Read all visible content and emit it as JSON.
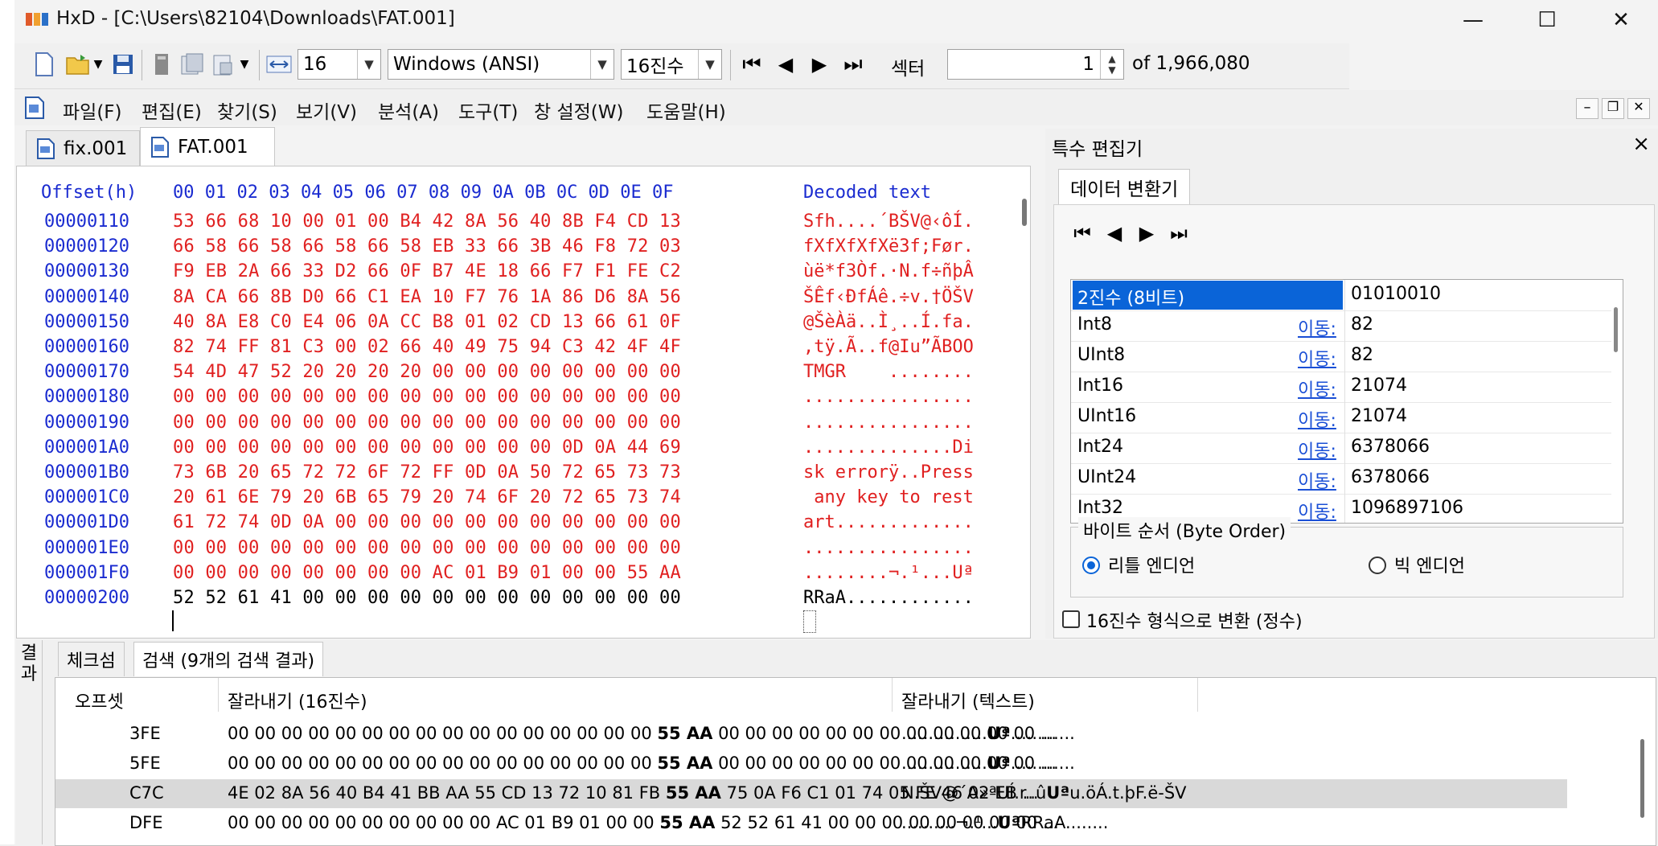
{
  "window": {
    "title": "HxD - [C:\\Users\\82104\\Downloads\\FAT.001]",
    "minimize": "—",
    "maximize": "☐",
    "close": "✕"
  },
  "toolbar": {
    "bytes_per_row": "16",
    "charset": "Windows (ANSI)",
    "number_base": "16진수",
    "sector_label": "섹터",
    "sector_value": "1",
    "sector_total": "of 1,966,080"
  },
  "menu": [
    "파일(F)",
    "편집(E)",
    "찾기(S)",
    "보기(V)",
    "분석(A)",
    "도구(T)",
    "창 설정(W)",
    "도움말(H)"
  ],
  "mdi_buttons": [
    "–",
    "❐",
    "✕"
  ],
  "tabs": [
    {
      "label": "fix.001",
      "active": false
    },
    {
      "label": "FAT.001",
      "active": true
    }
  ],
  "hex": {
    "header_offset": "Offset(h)",
    "header_bytes": "00 01 02 03 04 05 06 07 08 09 0A 0B 0C 0D 0E 0F",
    "header_text": "Decoded text",
    "rows": [
      {
        "offset": "00000110",
        "bytes": "53 66 68 10 00 01 00 B4 42 8A 56 40 8B F4 CD 13",
        "text": "Sfh....´BŠV@‹ôÍ."
      },
      {
        "offset": "00000120",
        "bytes": "66 58 66 58 66 58 66 58 EB 33 66 3B 46 F8 72 03",
        "text": "fXfXfXfXë3f;Før."
      },
      {
        "offset": "00000130",
        "bytes": "F9 EB 2A 66 33 D2 66 0F B7 4E 18 66 F7 F1 FE C2",
        "text": "ùë*f3Òf.·N.f÷ñþÂ"
      },
      {
        "offset": "00000140",
        "bytes": "8A CA 66 8B D0 66 C1 EA 10 F7 76 1A 86 D6 8A 56",
        "text": "ŠÊf‹ÐfÁê.÷v.†ÖŠV"
      },
      {
        "offset": "00000150",
        "bytes": "40 8A E8 C0 E4 06 0A CC B8 01 02 CD 13 66 61 0F",
        "text": "@ŠèÀä..Ì¸..Í.fa."
      },
      {
        "offset": "00000160",
        "bytes": "82 74 FF 81 C3 00 02 66 40 49 75 94 C3 42 4F 4F",
        "text": "‚tÿ.Ã..f@Iu”ÃBOO"
      },
      {
        "offset": "00000170",
        "bytes": "54 4D 47 52 20 20 20 20 00 00 00 00 00 00 00 00",
        "text": "TMGR    ........"
      },
      {
        "offset": "00000180",
        "bytes": "00 00 00 00 00 00 00 00 00 00 00 00 00 00 00 00",
        "text": "................"
      },
      {
        "offset": "00000190",
        "bytes": "00 00 00 00 00 00 00 00 00 00 00 00 00 00 00 00",
        "text": "................"
      },
      {
        "offset": "000001A0",
        "bytes": "00 00 00 00 00 00 00 00 00 00 00 00 0D 0A 44 69",
        "text": "..............Di"
      },
      {
        "offset": "000001B0",
        "bytes": "73 6B 20 65 72 72 6F 72 FF 0D 0A 50 72 65 73 73",
        "text": "sk errorÿ..Press"
      },
      {
        "offset": "000001C0",
        "bytes": "20 61 6E 79 20 6B 65 79 20 74 6F 20 72 65 73 74",
        "text": " any key to rest"
      },
      {
        "offset": "000001D0",
        "bytes": "61 72 74 0D 0A 00 00 00 00 00 00 00 00 00 00 00",
        "text": "art............."
      },
      {
        "offset": "000001E0",
        "bytes": "00 00 00 00 00 00 00 00 00 00 00 00 00 00 00 00",
        "text": "................"
      },
      {
        "offset": "000001F0",
        "bytes": "00 00 00 00 00 00 00 00 AC 01 B9 01 00 00 55 AA",
        "text": "........¬.¹...Uª"
      },
      {
        "offset": "00000200",
        "bytes": "52 52 61 41 00 00 00 00 00 00 00 00 00 00 00 00",
        "text": "RRaA............"
      }
    ]
  },
  "special_editor": {
    "title": "특수 편집기",
    "close": "×",
    "tab": "데이터 변환기",
    "rows": [
      {
        "type": "2진수 (8비트)",
        "goto": "",
        "value": "01010010",
        "selected": true
      },
      {
        "type": "Int8",
        "goto": "이동:",
        "value": "82"
      },
      {
        "type": "UInt8",
        "goto": "이동:",
        "value": "82"
      },
      {
        "type": "Int16",
        "goto": "이동:",
        "value": "21074"
      },
      {
        "type": "UInt16",
        "goto": "이동:",
        "value": "21074"
      },
      {
        "type": "Int24",
        "goto": "이동:",
        "value": "6378066"
      },
      {
        "type": "UInt24",
        "goto": "이동:",
        "value": "6378066"
      },
      {
        "type": "Int32",
        "goto": "이동:",
        "value": "1096897106"
      }
    ],
    "byte_order_title": "바이트 순서 (Byte Order)",
    "little_endian": "리틀 엔디언",
    "big_endian": "빅 엔디언",
    "hex_checkbox": "16진수 형식으로 변환 (정수)"
  },
  "results": {
    "side_label": "결과",
    "tabs": [
      "체크섬",
      "검색 (9개의 검색 결과)"
    ],
    "columns": [
      "오프셋",
      "잘라내기 (16진수)",
      "잘라내기 (텍스트)"
    ],
    "rows": [
      {
        "offset": "3FE",
        "hex_pre": "00 00 00 00 00 00 00 00 00 00 00 00 00 00 00 00 ",
        "hex_match": "55 AA",
        "hex_post": " 00 00 00 00 00 00 00 00 00 00 00 00 ...",
        "text_pre": "................",
        "text_match": "Uª",
        "text_post": "............"
      },
      {
        "offset": "5FE",
        "hex_pre": "00 00 00 00 00 00 00 00 00 00 00 00 00 00 00 00 ",
        "hex_match": "55 AA",
        "hex_post": " 00 00 00 00 00 00 00 00 00 00 00 00 ...",
        "text_pre": "................",
        "text_match": "Uª",
        "text_post": "............"
      },
      {
        "offset": "C7C",
        "hex_pre": "4E 02 8A 56 40 B4 41 BB AA 55 CD 13 72 10 81 FB ",
        "hex_match": "55 AA",
        "hex_post": " 75 0A F6 C1 01 74 05 FE 46 02 EB ...",
        "text_pre": "N.ŠV@´A»ªUÍ.r..û",
        "text_match": "Uª",
        "text_post": "u.öÁ.t.þF.ë-ŠV",
        "highlight": true
      },
      {
        "offset": "DFE",
        "hex_pre": "00 00 00 00 00 00 00 00 00 00 AC 01 B9 01 00 00 ",
        "hex_match": "55 AA",
        "hex_post": " 52 52 61 41 00 00 00 00 00 00 00 00 ...",
        "text_pre": "..........¬.¹...",
        "text_match": "Uª",
        "text_post": "RRaA........"
      }
    ]
  }
}
